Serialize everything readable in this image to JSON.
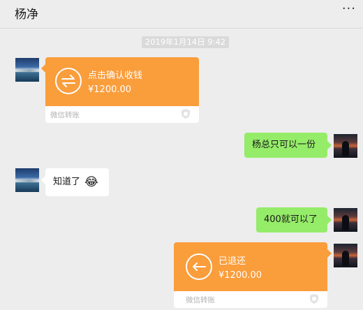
{
  "header": {
    "title": "杨净",
    "more_glyph": "···"
  },
  "timestamp": "2019年1月14日  9:42",
  "messages": {
    "transfer_received": {
      "label": "点击确认收钱",
      "amount": "¥1200.00",
      "footer": "微信转账"
    },
    "outgoing_1": {
      "text": "杨总只可以一份"
    },
    "incoming_1": {
      "text": "知道了",
      "emoji": "😂"
    },
    "outgoing_2": {
      "text": "400就可以了"
    },
    "transfer_returned": {
      "label": "已退还",
      "amount": "¥1200.00",
      "footer": "微信转账"
    }
  },
  "colors": {
    "background": "#ededed",
    "transfer_orange": "#fa9d3b",
    "outgoing_green": "#95ec69",
    "incoming_white": "#ffffff"
  },
  "icons": {
    "transfer_received": "exchange-arrows-icon",
    "transfer_returned": "return-arrow-icon",
    "footer": "wechat-pay-shield-icon"
  }
}
